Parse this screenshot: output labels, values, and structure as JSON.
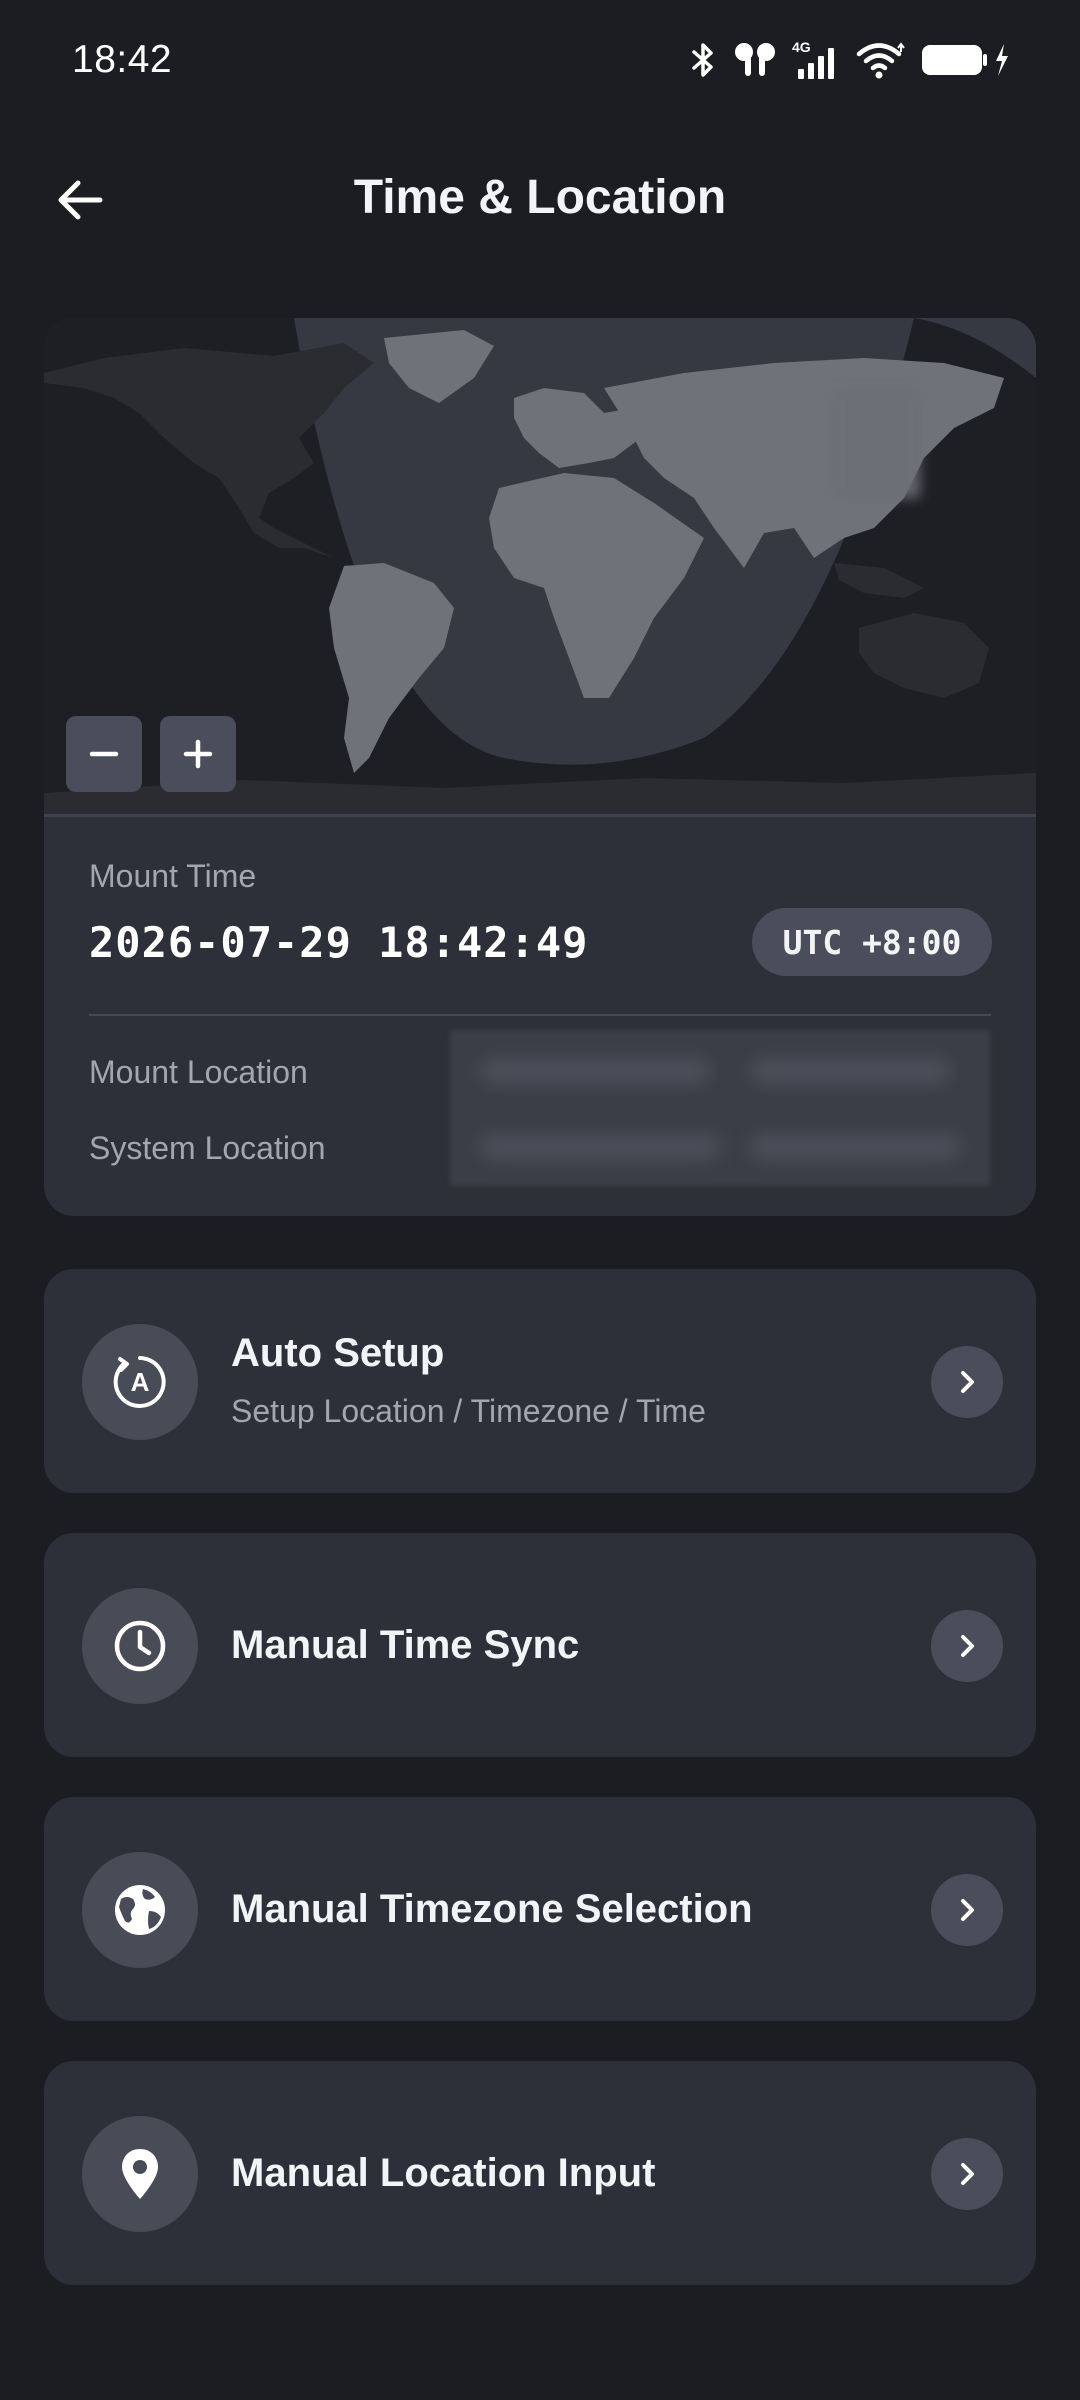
{
  "status_bar": {
    "time": "18:42",
    "network_label": "4G",
    "icons": [
      "bluetooth-icon",
      "earbuds-icon",
      "cellular-4g-icon",
      "wifi-icon",
      "battery-charging-icon"
    ]
  },
  "header": {
    "title": "Time & Location",
    "back_icon": "arrow-left-icon"
  },
  "map": {
    "zoom_out_label": "−",
    "zoom_in_label": "+"
  },
  "mount_time": {
    "label": "Mount Time",
    "value": "2026-07-29 18:42:49",
    "timezone": "UTC +8:00"
  },
  "location": {
    "mount_label": "Mount Location",
    "system_label": "System Location"
  },
  "options": [
    {
      "title": "Auto Setup",
      "subtitle": "Setup Location / Timezone / Time",
      "icon": "auto-setup-icon"
    },
    {
      "title": "Manual Time Sync",
      "icon": "clock-icon"
    },
    {
      "title": "Manual Timezone Selection",
      "icon": "globe-icon"
    },
    {
      "title": "Manual Location Input",
      "icon": "location-pin-icon"
    }
  ],
  "colors": {
    "background": "#1c1d22",
    "card": "#2e3039",
    "control": "#4a4e5a",
    "text_primary": "#f3f4f7",
    "text_secondary": "#a3a6ae"
  }
}
